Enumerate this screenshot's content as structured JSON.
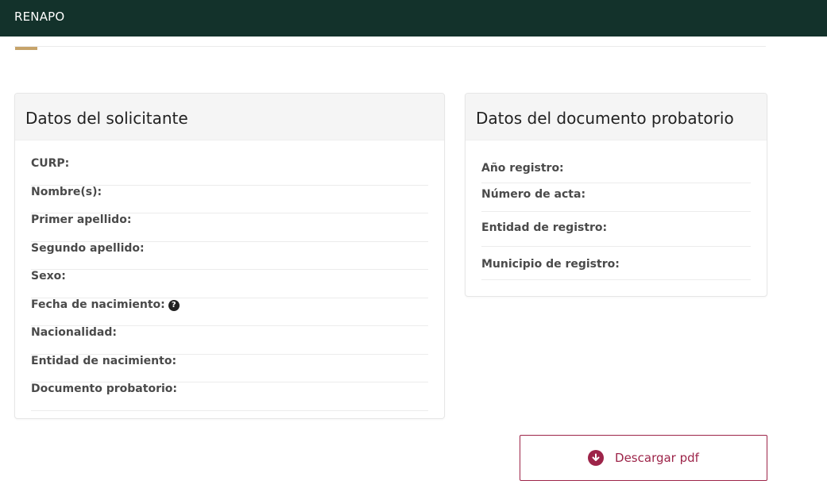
{
  "header": {
    "brand": "RENAPO"
  },
  "colors": {
    "header_bg": "#13322b",
    "accent": "#c6a36a",
    "button_accent": "#9d2449"
  },
  "solicitante": {
    "title": "Datos del solicitante",
    "fields": [
      {
        "label": "CURP:"
      },
      {
        "label": "Nombre(s):"
      },
      {
        "label": "Primer apellido:"
      },
      {
        "label": "Segundo apellido:"
      },
      {
        "label": "Sexo:"
      },
      {
        "label": "Fecha de nacimiento:",
        "icon": "question-circle-icon"
      },
      {
        "label": "Nacionalidad:"
      },
      {
        "label": "Entidad de nacimiento:"
      },
      {
        "label": "Documento probatorio:"
      }
    ]
  },
  "documento": {
    "title": "Datos del documento probatorio",
    "fields": [
      {
        "label": "Año registro:"
      },
      {
        "label": "Número de acta:"
      },
      {
        "label": "Entidad de registro:"
      },
      {
        "label": "Municipio de registro:"
      }
    ]
  },
  "actions": {
    "download_label": "Descargar pdf",
    "download_icon": "arrow-down-circle-icon"
  }
}
